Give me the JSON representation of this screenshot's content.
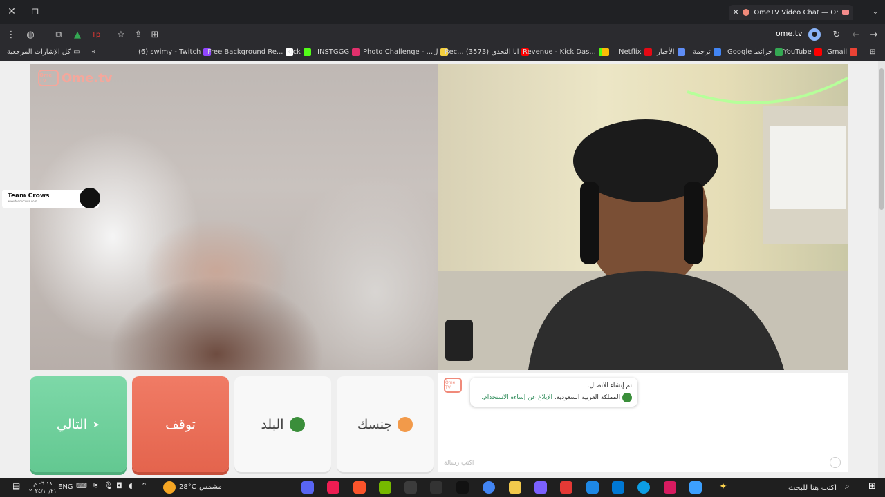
{
  "browser": {
    "tab_title": "OmeTV Video Chat — Ome",
    "address": "ome.tv",
    "bookmarks": [
      {
        "label": "Gmail",
        "color": "#ea4335"
      },
      {
        "label": "YouTube",
        "color": "#ff0000"
      },
      {
        "label": "Google خرائط",
        "color": "#34a853"
      },
      {
        "label": "ترجمة",
        "color": "#4285f4"
      },
      {
        "label": "الأخبار",
        "color": "#5f8df6"
      },
      {
        "label": "Netflix",
        "color": "#e50914"
      },
      {
        "label": "Revenue - Kick Das...",
        "color": "#53fc18"
      },
      {
        "label": "Rec... انا التحدي (3573)",
        "color": "#ff0000"
      },
      {
        "label": "Photo Challenge - ...ل",
        "color": "#f4d03f"
      },
      {
        "label": "INSTGGG",
        "color": "#e1306c"
      },
      {
        "label": "kick",
        "color": "#53fc18"
      },
      {
        "label": "Free Background Re...",
        "color": "#ffffff"
      },
      {
        "label": "(6) swimy - Twitch",
        "color": "#9146ff"
      }
    ],
    "all_bookmarks": "كل الإشارات المرجعية"
  },
  "video": {
    "logo_text": "Ome.tv",
    "logo_tv": "Ome TV",
    "team_badge": "Team Crows",
    "team_badge_sub": "www.teamcrows.com"
  },
  "buttons": {
    "next": "التالي",
    "stop": "توقف",
    "country": "البلد",
    "gender": "جنسك"
  },
  "chat": {
    "line1": "تم إنشاء الاتصال.",
    "line2_country": "المملكة العربية السعودية.",
    "report_link": "الإبلاغ عن إساءة الاستخدام.",
    "placeholder": "اكتب رسالة"
  },
  "taskbar": {
    "search": "اكتب هنا للبحث",
    "weather": "مشمس",
    "temp": "28°C",
    "lang": "ENG",
    "time": "٠٦:١٨ م",
    "date": "٢٠٢٤/١٠/٢١"
  }
}
